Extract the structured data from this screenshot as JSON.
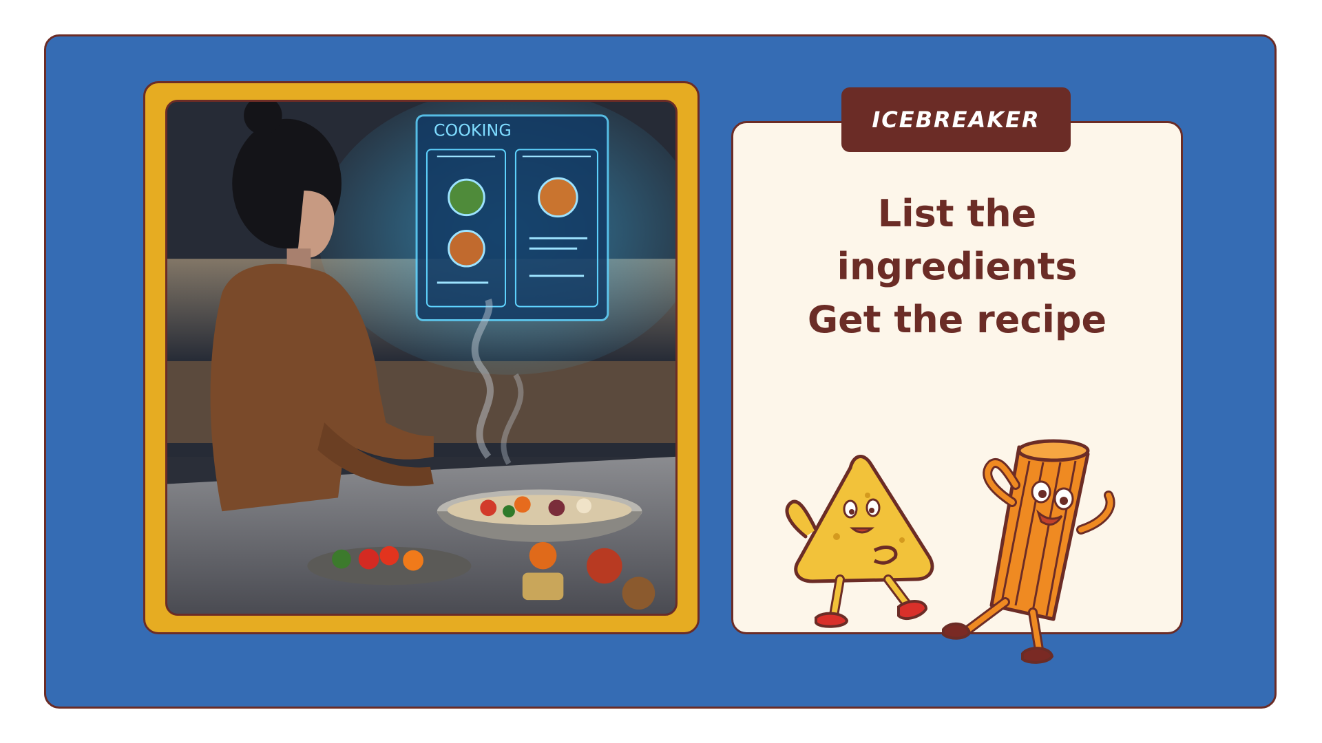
{
  "photo": {
    "screen_title": "COOKING"
  },
  "card": {
    "tag": "ICEBREAKER",
    "headline": [
      "List the",
      "ingredients",
      "Get the recipe"
    ]
  },
  "colors": {
    "background": "#356cb4",
    "frame": "#e6ac22",
    "outline": "#6b2c26",
    "card": "#fdf6ea",
    "hologram": "#3ec2ff"
  },
  "icons": [
    "nacho-mascot-icon",
    "churro-mascot-icon"
  ]
}
